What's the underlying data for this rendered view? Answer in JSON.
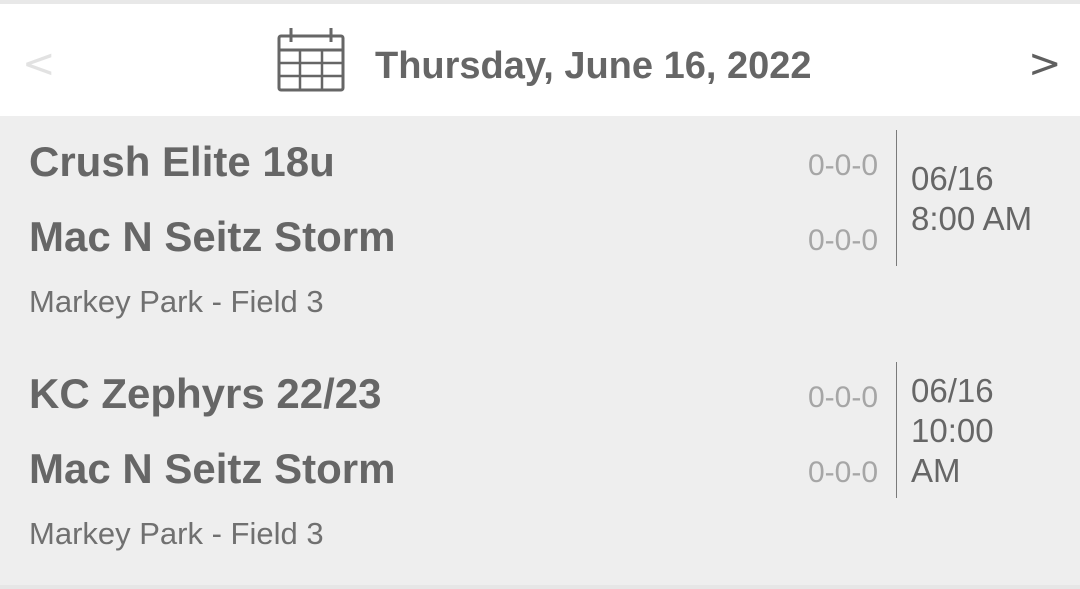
{
  "header": {
    "prev_label": "<",
    "next_label": ">",
    "date_title": "Thursday, June 16, 2022",
    "calendar_icon": "calendar-icon"
  },
  "games": [
    {
      "team1": "Crush Elite 18u",
      "team1_record": "0-0-0",
      "team2": "Mac N Seitz Storm",
      "team2_record": "0-0-0",
      "date": "06/16",
      "time": "8:00 AM",
      "venue": "Markey Park - Field 3"
    },
    {
      "team1": "KC Zephyrs 22/23",
      "team1_record": "0-0-0",
      "team2": "Mac N Seitz Storm",
      "team2_record": "0-0-0",
      "date": "06/16",
      "time": "10:00 AM",
      "venue": "Markey Park - Field 3"
    }
  ],
  "colors": {
    "header_bg": "#ffffff",
    "list_bg": "#eeeeee",
    "text": "#666666",
    "record_text": "#a6a6a6"
  }
}
